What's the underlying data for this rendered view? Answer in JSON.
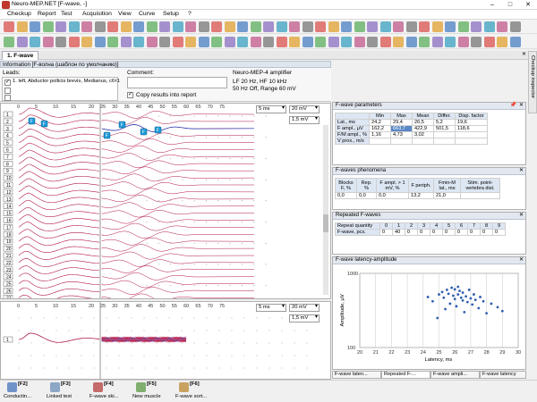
{
  "window": {
    "title": "Neuro-MEP.NET [F-wave, -]",
    "minimize": "–",
    "maximize": "□",
    "close": "✕"
  },
  "menu": [
    "Checkup",
    "Report",
    "Test",
    "Acquisition",
    "View",
    "Curve",
    "Setup",
    "?"
  ],
  "tab": {
    "label": "1. F-wave"
  },
  "info": {
    "header": "Information [F-волна (шаблон по умолчанию)]",
    "leads_label": "Leads:",
    "lead_1": "1. left, Abductor pollicis brevis, Medianus, с6т1",
    "comment_label": "Comment:",
    "copy_label": "Copy results into report",
    "amp_title": "Neuro-MEP-4 amplifier",
    "amp_line1": "LF  20 Hz,  HF  10 kHz",
    "amp_line2": "50 Hz  Off,  Range 60 mV"
  },
  "traces": {
    "x_ticks_left": [
      "0",
      "5",
      "10",
      "15",
      "20"
    ],
    "x_ticks_right": [
      "25",
      "30",
      "35",
      "40",
      "45",
      "50",
      "55",
      "60",
      "65",
      "70",
      "75"
    ],
    "sweep_labels": [
      "1",
      "2",
      "3",
      "4",
      "5",
      "6",
      "7",
      "8",
      "9",
      "10",
      "11",
      "12",
      "13",
      "14",
      "15",
      "16",
      "17",
      "18",
      "19",
      "20",
      "21",
      "22",
      "23",
      "24",
      "25",
      "26",
      "27"
    ],
    "timebase": "5 ms",
    "sensitivity_1": "20 mV",
    "sensitivity_2": "1,5 mV",
    "markers": [
      "F",
      "F",
      "F",
      "F"
    ],
    "bottom_ticks_left": [
      "0",
      "5",
      "10",
      "15",
      "20"
    ],
    "bottom_ticks_right": [
      "25",
      "30",
      "35",
      "40",
      "45",
      "50",
      "55",
      "60",
      "65",
      "70",
      "75"
    ],
    "bottom_timebase": "5 ms",
    "bottom_sens_1": "20 mV",
    "bottom_sens_2": "1,5 mV",
    "bottom_sweep": "1"
  },
  "fparams": {
    "title": "F-wave parameters",
    "headers": [
      "",
      "Min",
      "Max",
      "Mean",
      "Differ.",
      "Disp. factor"
    ],
    "rows": [
      [
        "Lat., ms",
        "24,2",
        "29,4",
        "26,5",
        "5,2",
        "19,6"
      ],
      [
        "F ampl., µV",
        "162,2",
        "663,7",
        "422,9",
        "501,5",
        "118,6"
      ],
      [
        "F/M ampl., %",
        "1,16",
        "4,73",
        "3,02",
        "",
        ""
      ],
      [
        "V prox., m/s",
        "",
        "",
        "",
        "",
        ""
      ]
    ]
  },
  "fphen": {
    "title": "F-waves phenomena",
    "headers": [
      "Blocks F, %",
      "Rep. %",
      "F ampl. > 1 mV, %",
      "F periph.",
      "Fmin-M lat., ms",
      "Stim. point-vertebra dist."
    ],
    "values": [
      "0,0",
      "0,0",
      "0,0",
      "13,2",
      "21,0",
      ""
    ]
  },
  "repeated": {
    "title": "Repeated F-waves",
    "headers": [
      "Repeat quantity",
      "0",
      "1",
      "2",
      "3",
      "4",
      "5",
      "6",
      "7",
      "8",
      "9"
    ],
    "row_label": "F-wave, pcs.",
    "values": [
      "0",
      "40",
      "0",
      "0",
      "0",
      "0",
      "0",
      "0",
      "0",
      "0"
    ]
  },
  "scatter": {
    "title": "F-wave latency-amplitude",
    "chart_data": {
      "type": "scatter",
      "xlabel": "Latency, ms",
      "ylabel": "Amplitude, µV",
      "xlim": [
        20,
        30
      ],
      "ylim": [
        100,
        1000
      ],
      "yscale": "log",
      "x_ticks": [
        "20",
        "21",
        "22",
        "23",
        "24",
        "25",
        "26",
        "27",
        "28",
        "29",
        "30"
      ],
      "y_ticks": [
        "1000",
        "100"
      ],
      "points": [
        [
          24.3,
          480
        ],
        [
          24.6,
          420
        ],
        [
          25.0,
          520
        ],
        [
          25.2,
          560
        ],
        [
          25.3,
          470
        ],
        [
          25.5,
          600
        ],
        [
          25.6,
          530
        ],
        [
          25.7,
          390
        ],
        [
          25.8,
          640
        ],
        [
          25.9,
          500
        ],
        [
          26.0,
          610
        ],
        [
          26.0,
          450
        ],
        [
          26.1,
          360
        ],
        [
          26.2,
          520
        ],
        [
          26.3,
          580
        ],
        [
          26.4,
          470
        ],
        [
          26.5,
          430
        ],
        [
          26.5,
          550
        ],
        [
          26.6,
          300
        ],
        [
          26.7,
          490
        ],
        [
          26.8,
          410
        ],
        [
          26.9,
          600
        ],
        [
          27.0,
          460
        ],
        [
          27.1,
          380
        ],
        [
          27.2,
          520
        ],
        [
          27.3,
          440
        ],
        [
          27.5,
          340
        ],
        [
          27.6,
          480
        ],
        [
          27.8,
          420
        ],
        [
          28.0,
          290
        ],
        [
          28.3,
          390
        ],
        [
          28.7,
          350
        ],
        [
          29.0,
          310
        ],
        [
          26.2,
          660
        ],
        [
          25.4,
          330
        ],
        [
          24.9,
          250
        ]
      ]
    }
  },
  "bottom_tabs": [
    "F-wave laten...",
    "Repeated F-...",
    "F-wave ampli...",
    "F-wave latency"
  ],
  "side_tab": "Checkup inspector",
  "fkeys": [
    {
      "key": "[F2]",
      "label": "Conductin..."
    },
    {
      "key": "[F3]",
      "label": "Linked test"
    },
    {
      "key": "[F4]",
      "label": "F-wave ski..."
    },
    {
      "key": "[F5]",
      "label": "New muscle"
    },
    {
      "key": "[F6]",
      "label": "F-wave sort..."
    }
  ],
  "colors": {
    "trace_red": "#b0174a",
    "trace_blue": "#1a2fb0",
    "marker": "#1e9ad6",
    "selected": "#5b87c7"
  }
}
